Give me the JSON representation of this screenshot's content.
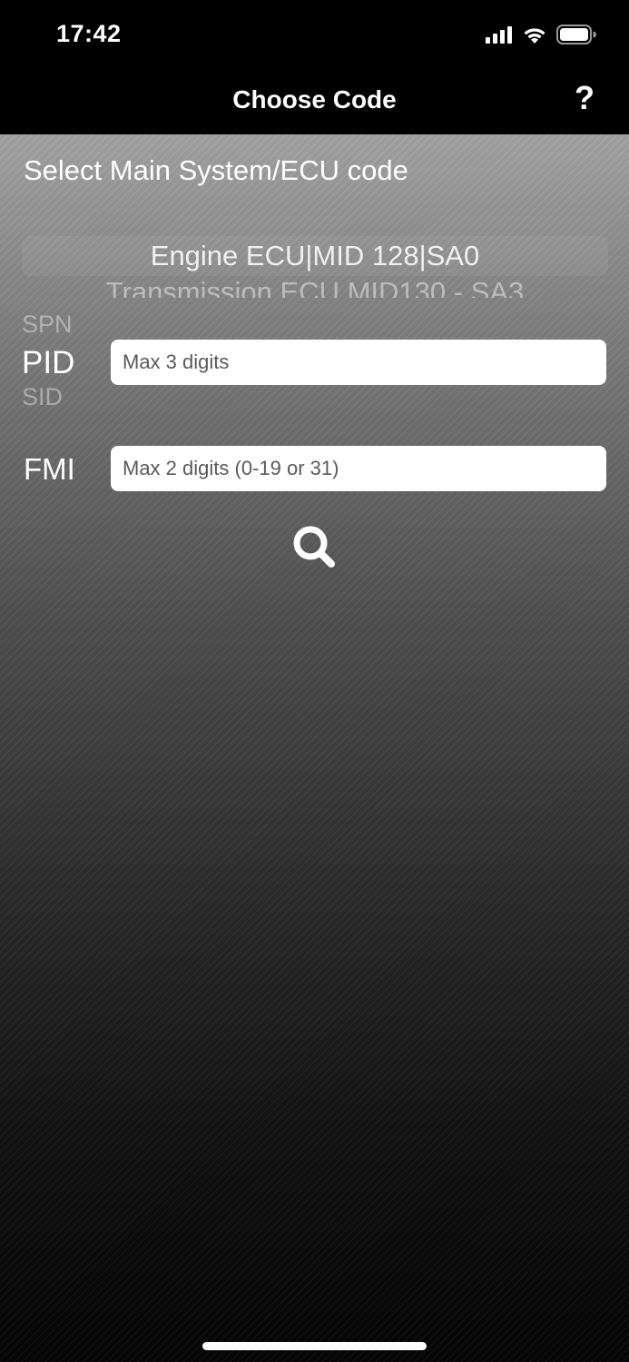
{
  "status_bar": {
    "time": "17:42",
    "icons": [
      "cellular-signal-icon",
      "wifi-icon",
      "battery-icon"
    ]
  },
  "nav": {
    "title": "Choose Code",
    "help_label": "?"
  },
  "main": {
    "heading": "Select Main System/ECU code",
    "ecu_picker": {
      "selected": "Engine ECU|MID 128|SA0",
      "next": "Transmission ECU MID130 - SA3"
    },
    "type_picker": {
      "prev": "SPN",
      "selected": "PID",
      "next": "SID"
    },
    "pid_input": {
      "placeholder": "Max 3 digits",
      "value": ""
    },
    "fmi": {
      "label": "FMI",
      "placeholder": "Max 2 digits (0-19 or 31)",
      "value": ""
    },
    "search_icon": "search-icon"
  },
  "colors": {
    "bar_background": "#000000",
    "text": "#ffffff",
    "input_background": "#ffffff"
  }
}
